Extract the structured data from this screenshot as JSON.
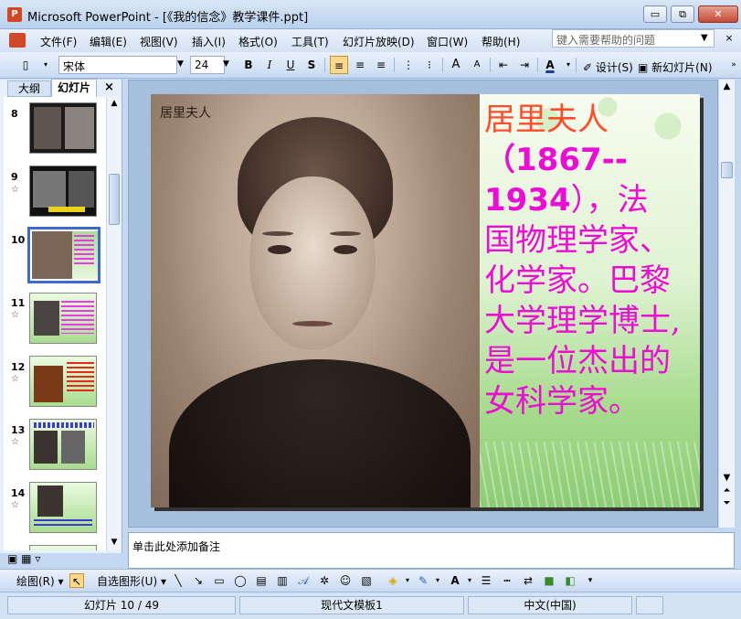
{
  "window": {
    "title": "Microsoft PowerPoint - [《我的信念》教学课件.ppt]",
    "app_icon": "powerpoint-icon",
    "minimize_label": "▭",
    "restore_label": "⧉",
    "close_label": "✕"
  },
  "menu": {
    "items": [
      "文件(F)",
      "编辑(E)",
      "视图(V)",
      "插入(I)",
      "格式(O)",
      "工具(T)",
      "幻灯片放映(D)",
      "窗口(W)",
      "帮助(H)"
    ],
    "help_placeholder": "键入需要帮助的问题",
    "mdi_close": "×"
  },
  "toolbar": {
    "font_name": "宋体",
    "font_size": "24",
    "bold": "B",
    "italic": "I",
    "underline": "U",
    "shadow": "S",
    "grow_font": "A",
    "shrink_font": "A",
    "font_color": "A",
    "design_label": "设计(S)",
    "new_slide_label": "新幻灯片(N)"
  },
  "left_panel": {
    "tab_outline": "大纲",
    "tab_slides": "幻灯片",
    "close": "×",
    "slides": [
      {
        "num": "8",
        "star": ""
      },
      {
        "num": "9",
        "star": "☆"
      },
      {
        "num": "10",
        "star": "",
        "selected": true
      },
      {
        "num": "11",
        "star": "☆"
      },
      {
        "num": "12",
        "star": "☆"
      },
      {
        "num": "13",
        "star": "☆"
      },
      {
        "num": "14",
        "star": "☆"
      }
    ]
  },
  "slide": {
    "photo_caption": "居里夫人",
    "name_line": "居里夫人",
    "bold_line1": "（1867--",
    "bold_line2": "1934",
    "tail_line2": "），法",
    "lines": [
      "国物理学家、",
      "化学家。巴黎",
      "大学理学博士,",
      "是一位杰出的",
      "女科学家。"
    ]
  },
  "notes": {
    "placeholder": "单击此处添加备注"
  },
  "drawbar": {
    "draw_label": "绘图(R)",
    "autoshape_label": "自选图形(U)"
  },
  "status": {
    "slide_pos": "幻灯片 10 / 49",
    "template": "现代文模板1",
    "language": "中文(中国)"
  },
  "colors": {
    "name_color": "#ff4d2b",
    "text_color": "#ef0bd6",
    "ribbon_blue": "#c7daf2"
  }
}
